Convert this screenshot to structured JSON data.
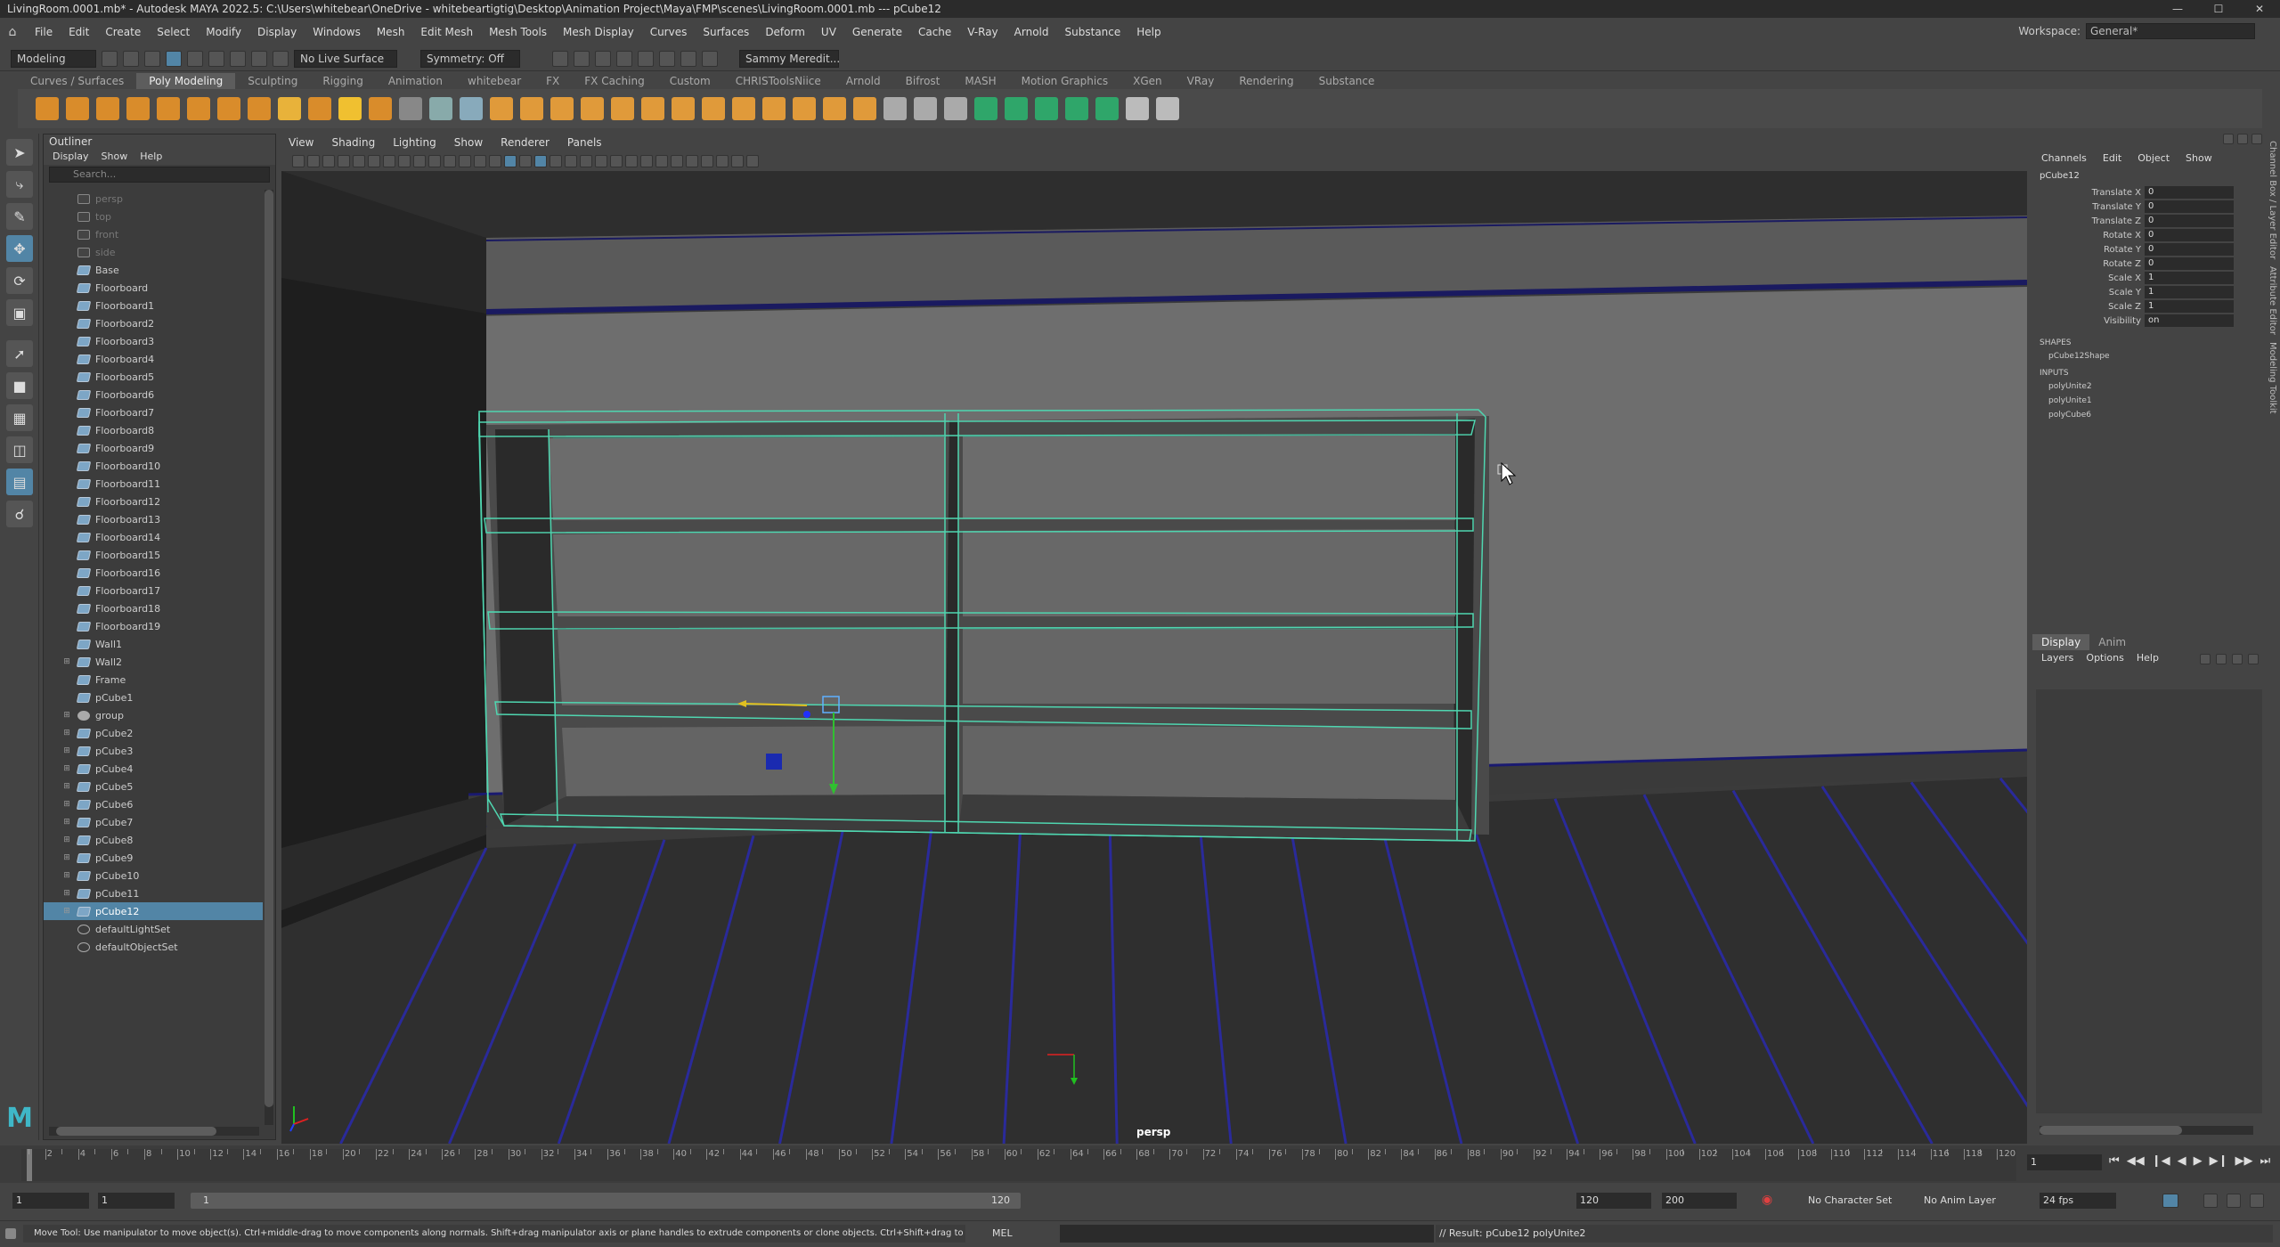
{
  "title": "LivingRoom.0001.mb* - Autodesk MAYA 2022.5: C:\\Users\\whitebear\\OneDrive - whitebeartigtig\\Desktop\\Animation Project\\Maya\\FMP\\scenes\\LivingRoom.0001.mb  ---  pCube12",
  "menu": [
    "File",
    "Edit",
    "Create",
    "Select",
    "Modify",
    "Display",
    "Windows",
    "Mesh",
    "Edit Mesh",
    "Mesh Tools",
    "Mesh Display",
    "Curves",
    "Surfaces",
    "Deform",
    "UV",
    "Generate",
    "Cache",
    "V-Ray",
    "Arnold",
    "Substance",
    "Help"
  ],
  "workspace": {
    "label": "Workspace:",
    "value": "General*"
  },
  "status": {
    "mode": "Modeling",
    "live": "No Live Surface",
    "symmetry": "Symmetry: Off",
    "user": "Sammy Meredit..."
  },
  "shelf_tabs": [
    "Curves / Surfaces",
    "Poly Modeling",
    "Sculpting",
    "Rigging",
    "Animation",
    "whitebear",
    "FX",
    "FX Caching",
    "Custom",
    "CHRISToolsNiice",
    "Arnold",
    "Bifrost",
    "MASH",
    "Motion Graphics",
    "XGen",
    "VRay",
    "Rendering",
    "Substance"
  ],
  "shelf_active": "Poly Modeling",
  "outliner": {
    "title": "Outliner",
    "menu": [
      "Display",
      "Show",
      "Help"
    ],
    "search_placeholder": "Search...",
    "items": [
      {
        "name": "persp",
        "kind": "cam",
        "dim": true
      },
      {
        "name": "top",
        "kind": "cam",
        "dim": true
      },
      {
        "name": "front",
        "kind": "cam",
        "dim": true
      },
      {
        "name": "side",
        "kind": "cam",
        "dim": true
      },
      {
        "name": "Base",
        "kind": "mesh"
      },
      {
        "name": "Floorboard",
        "kind": "mesh"
      },
      {
        "name": "Floorboard1",
        "kind": "mesh"
      },
      {
        "name": "Floorboard2",
        "kind": "mesh"
      },
      {
        "name": "Floorboard3",
        "kind": "mesh"
      },
      {
        "name": "Floorboard4",
        "kind": "mesh"
      },
      {
        "name": "Floorboard5",
        "kind": "mesh"
      },
      {
        "name": "Floorboard6",
        "kind": "mesh"
      },
      {
        "name": "Floorboard7",
        "kind": "mesh"
      },
      {
        "name": "Floorboard8",
        "kind": "mesh"
      },
      {
        "name": "Floorboard9",
        "kind": "mesh"
      },
      {
        "name": "Floorboard10",
        "kind": "mesh"
      },
      {
        "name": "Floorboard11",
        "kind": "mesh"
      },
      {
        "name": "Floorboard12",
        "kind": "mesh"
      },
      {
        "name": "Floorboard13",
        "kind": "mesh"
      },
      {
        "name": "Floorboard14",
        "kind": "mesh"
      },
      {
        "name": "Floorboard15",
        "kind": "mesh"
      },
      {
        "name": "Floorboard16",
        "kind": "mesh"
      },
      {
        "name": "Floorboard17",
        "kind": "mesh"
      },
      {
        "name": "Floorboard18",
        "kind": "mesh"
      },
      {
        "name": "Floorboard19",
        "kind": "mesh"
      },
      {
        "name": "Wall1",
        "kind": "mesh"
      },
      {
        "name": "Wall2",
        "kind": "mesh",
        "expand": true
      },
      {
        "name": "Frame",
        "kind": "mesh"
      },
      {
        "name": "pCube1",
        "kind": "mesh"
      },
      {
        "name": "group",
        "kind": "grp",
        "expand": true
      },
      {
        "name": "pCube2",
        "kind": "mesh",
        "expand": true
      },
      {
        "name": "pCube3",
        "kind": "mesh",
        "expand": true
      },
      {
        "name": "pCube4",
        "kind": "mesh",
        "expand": true
      },
      {
        "name": "pCube5",
        "kind": "mesh",
        "expand": true
      },
      {
        "name": "pCube6",
        "kind": "mesh",
        "expand": true
      },
      {
        "name": "pCube7",
        "kind": "mesh",
        "expand": true
      },
      {
        "name": "pCube8",
        "kind": "mesh",
        "expand": true
      },
      {
        "name": "pCube9",
        "kind": "mesh",
        "expand": true
      },
      {
        "name": "pCube10",
        "kind": "mesh",
        "expand": true
      },
      {
        "name": "pCube11",
        "kind": "mesh",
        "expand": true
      },
      {
        "name": "pCube12",
        "kind": "mesh",
        "expand": true,
        "selected": true
      },
      {
        "name": "defaultLightSet",
        "kind": "set"
      },
      {
        "name": "defaultObjectSet",
        "kind": "set"
      }
    ]
  },
  "viewport": {
    "menu": [
      "View",
      "Shading",
      "Lighting",
      "Show",
      "Renderer",
      "Panels"
    ],
    "camera_label": "persp"
  },
  "channelbox": {
    "menu": [
      "Channels",
      "Edit",
      "Object",
      "Show"
    ],
    "object": "pCube12",
    "channels": [
      {
        "label": "Translate X",
        "value": "0"
      },
      {
        "label": "Translate Y",
        "value": "0"
      },
      {
        "label": "Translate Z",
        "value": "0"
      },
      {
        "label": "Rotate X",
        "value": "0"
      },
      {
        "label": "Rotate Y",
        "value": "0"
      },
      {
        "label": "Rotate Z",
        "value": "0"
      },
      {
        "label": "Scale X",
        "value": "1"
      },
      {
        "label": "Scale Y",
        "value": "1"
      },
      {
        "label": "Scale Z",
        "value": "1"
      },
      {
        "label": "Visibility",
        "value": "on"
      }
    ],
    "shapes_label": "SHAPES",
    "shapes": [
      "pCube12Shape"
    ],
    "inputs_label": "INPUTS",
    "inputs": [
      "polyUnite2",
      "polyUnite1",
      "polyCube6"
    ]
  },
  "layers": {
    "tabs": [
      "Display",
      "Anim"
    ],
    "menu": [
      "Layers",
      "Options",
      "Help"
    ]
  },
  "side_tabs": [
    "Channel Box / Layer Editor",
    "Attribute Editor",
    "Modeling Toolkit"
  ],
  "timeline": {
    "ticks": [
      "2",
      "4",
      "6",
      "8",
      "10",
      "12",
      "14",
      "16",
      "18",
      "20",
      "22",
      "24",
      "26",
      "28",
      "30",
      "32",
      "34",
      "36",
      "38",
      "40",
      "42",
      "44",
      "46",
      "48",
      "50",
      "52",
      "54",
      "56",
      "58",
      "60",
      "62",
      "64",
      "66",
      "68",
      "70",
      "72",
      "74",
      "76",
      "78",
      "80",
      "82",
      "84",
      "86",
      "88",
      "90",
      "92",
      "94",
      "96",
      "98",
      "100",
      "102",
      "104",
      "106",
      "108",
      "110",
      "112",
      "114",
      "116",
      "118",
      "120"
    ],
    "current_frame": "1"
  },
  "range": {
    "start": "1",
    "playback_start": "1",
    "slider_start": "1",
    "slider_end": "120",
    "playback_end": "120",
    "end": "200",
    "character_set": "No Character Set",
    "anim_layer": "No Anim Layer",
    "fps": "24 fps"
  },
  "help_line": "Move Tool: Use manipulator to move object(s). Ctrl+middle-drag to move components along normals. Shift+drag manipulator axis or plane handles to extrude components or clone objects. Ctrl+Shift+drag to constrain movement to a con",
  "cmd": {
    "lang": "MEL",
    "result": "// Result: pCube12 polyUnite2"
  },
  "colors": {
    "selection": "#5285a6",
    "wireframe": "#4fd6b0",
    "floor_lines": "#2a2a9a"
  }
}
